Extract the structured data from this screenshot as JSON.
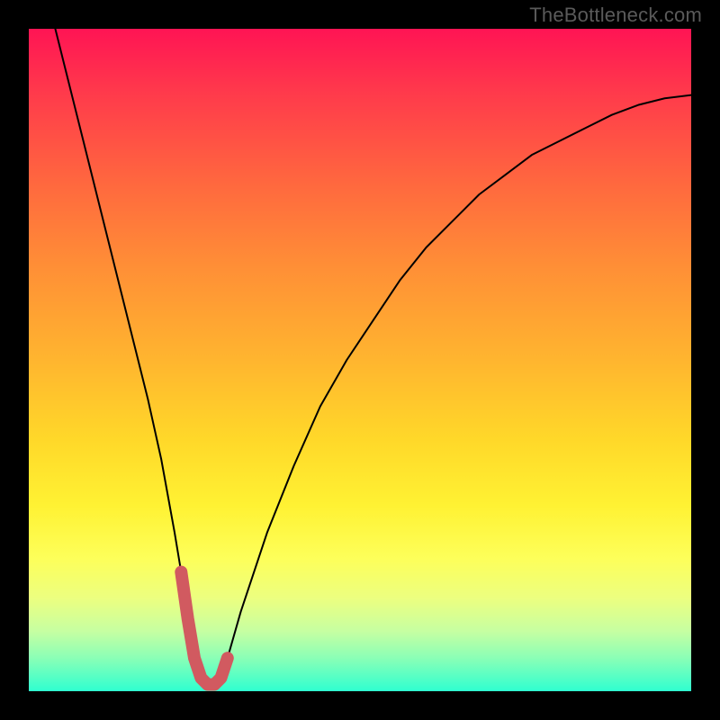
{
  "watermark": "TheBottleneck.com",
  "colors": {
    "curve": "#000000",
    "highlight": "#d15a60"
  },
  "chart_data": {
    "type": "line",
    "title": "",
    "xlabel": "",
    "ylabel": "",
    "xlim": [
      0,
      100
    ],
    "ylim": [
      0,
      100
    ],
    "grid": false,
    "legend": false,
    "series": [
      {
        "name": "bottleneck-curve",
        "x": [
          4,
          6,
          8,
          10,
          12,
          14,
          16,
          18,
          20,
          22,
          23,
          24,
          25,
          26,
          27,
          28,
          29,
          30,
          32,
          36,
          40,
          44,
          48,
          52,
          56,
          60,
          64,
          68,
          72,
          76,
          80,
          84,
          88,
          92,
          96,
          100
        ],
        "y": [
          100,
          92,
          84,
          76,
          68,
          60,
          52,
          44,
          35,
          24,
          18,
          11,
          5,
          2,
          1,
          1,
          2,
          5,
          12,
          24,
          34,
          43,
          50,
          56,
          62,
          67,
          71,
          75,
          78,
          81,
          83,
          85,
          87,
          88.5,
          89.5,
          90
        ]
      },
      {
        "name": "optimal-zone",
        "x": [
          23,
          24,
          25,
          26,
          27,
          28,
          29,
          30
        ],
        "y": [
          18,
          11,
          5,
          2,
          1,
          1,
          2,
          5
        ]
      }
    ],
    "annotations": []
  }
}
